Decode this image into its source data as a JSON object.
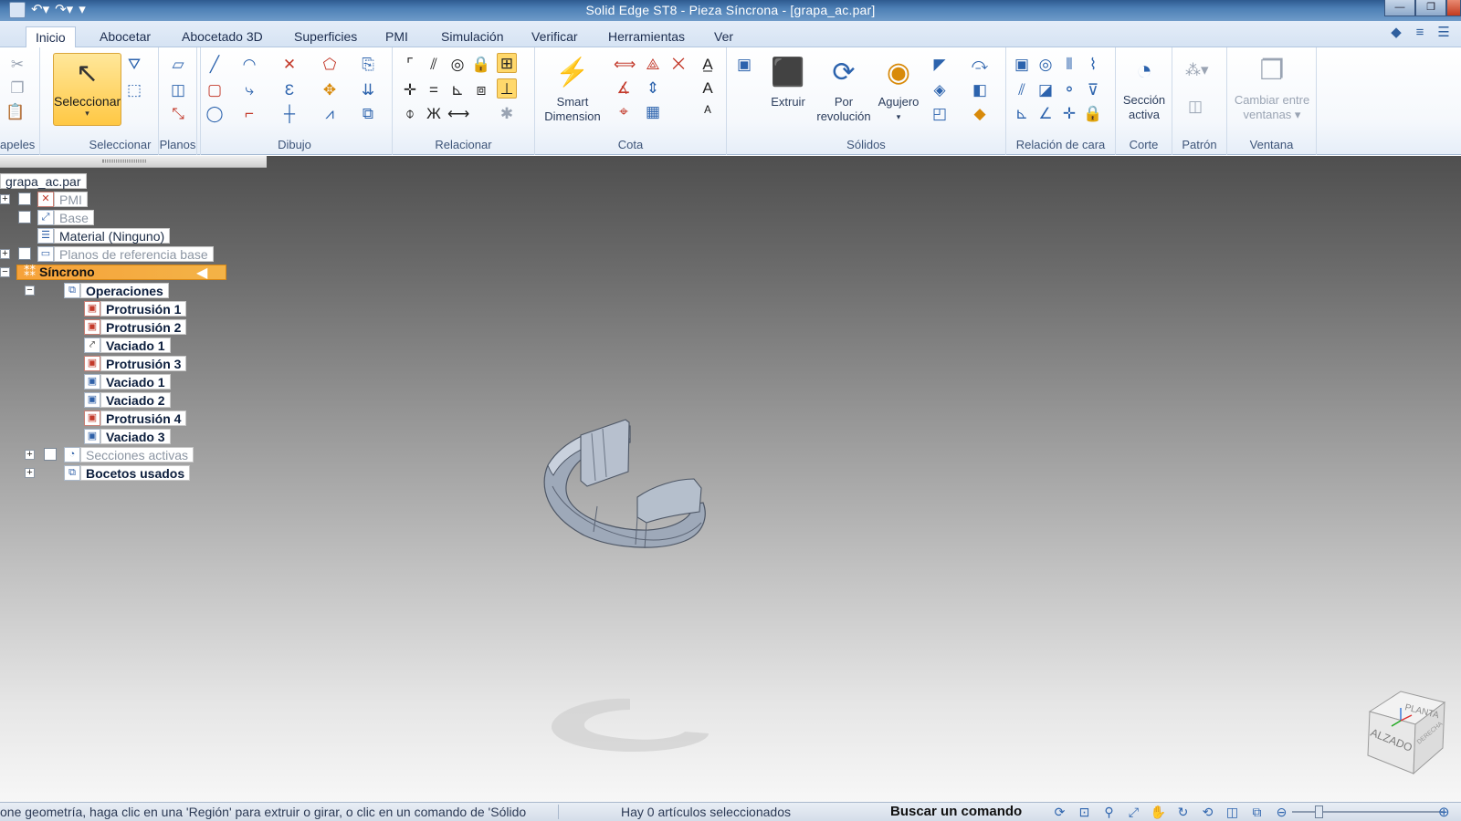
{
  "window": {
    "title": "Solid Edge ST8 - Pieza Síncrona - [grapa_ac.par]",
    "quick_access": [
      "save-icon",
      "undo-icon",
      "redo-icon",
      "customize-icon"
    ]
  },
  "tabs": [
    {
      "label": "Inicio",
      "active": true
    },
    {
      "label": "Abocetar"
    },
    {
      "label": "Abocetado 3D"
    },
    {
      "label": "Superficies"
    },
    {
      "label": "PMI"
    },
    {
      "label": "Simulación"
    },
    {
      "label": "Verificar"
    },
    {
      "label": "Herramientas"
    },
    {
      "label": "Ver"
    }
  ],
  "ribbon": {
    "groups": {
      "papeles": "apeles",
      "seleccionar": "Seleccionar",
      "planos": "Planos",
      "dibujo": "Dibujo",
      "relacionar": "Relacionar",
      "cota": "Cota",
      "solidos": "Sólidos",
      "relacion_cara": "Relación de cara",
      "corte": "Corte",
      "patron": "Patrón",
      "ventana": "Ventana"
    },
    "select_button": "Seleccionar",
    "smart_dimension": [
      "Smart",
      "Dimension"
    ],
    "extruir": "Extruir",
    "por_revolucion": [
      "Por",
      "revolución"
    ],
    "agujero": "Agujero",
    "seccion_activa": [
      "Sección",
      "activa"
    ],
    "cambiar_ventanas": [
      "Cambiar entre",
      "ventanas"
    ]
  },
  "tree": {
    "root": "grapa_ac.par",
    "nodes": {
      "pmi": "PMI",
      "base": "Base",
      "material": "Material (Ninguno)",
      "planos": "Planos de referencia base",
      "sincrono": "Síncrono",
      "operaciones": "Operaciones",
      "ops": [
        "Protrusión 1",
        "Protrusión 2",
        "Vaciado 1",
        "Protrusión 3",
        "Vaciado 1",
        "Vaciado 2",
        "Protrusión 4",
        "Vaciado 3"
      ],
      "secciones": "Secciones activas",
      "bocetos": "Bocetos usados"
    }
  },
  "viewcube": {
    "top": "PLANTA",
    "front": "ALZADO",
    "right": "DERECHA"
  },
  "status": {
    "message": "one geometría, haga clic en una 'Región' para extruir o girar, o clic en un comando de 'Sólido",
    "selection": "Hay 0 artículos seleccionados",
    "find": "Buscar un comando"
  }
}
